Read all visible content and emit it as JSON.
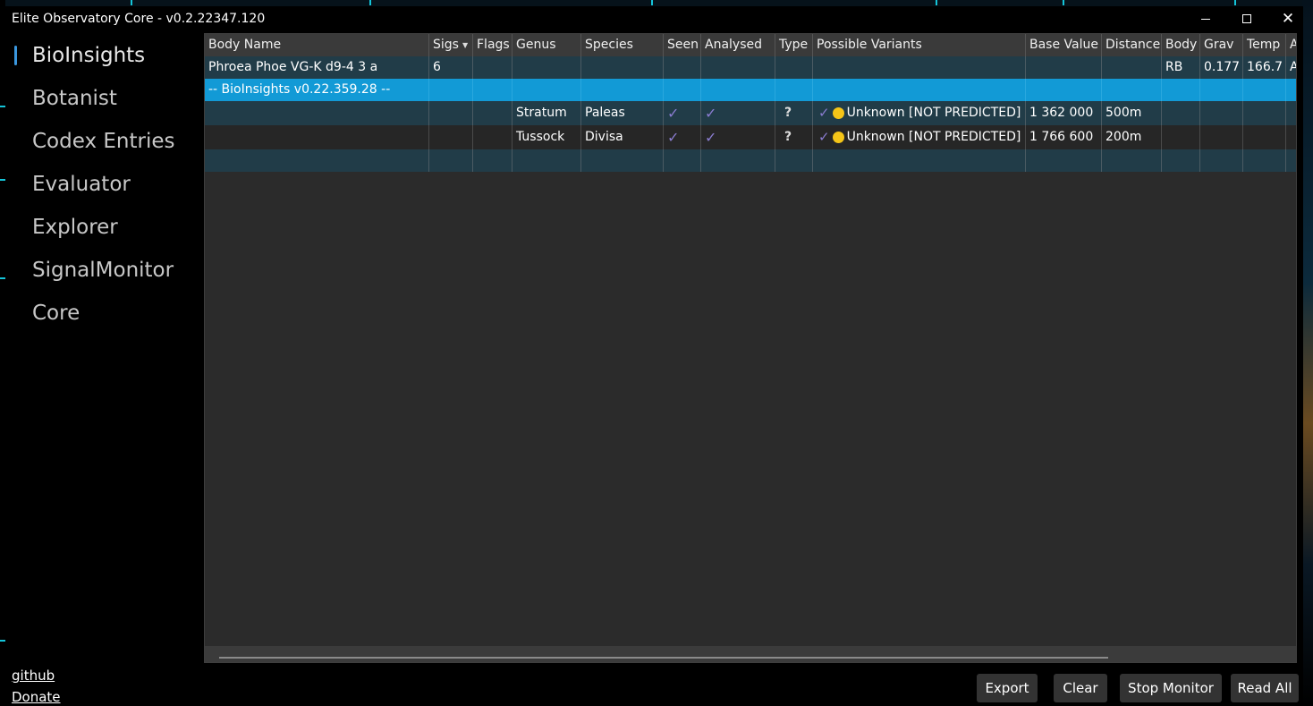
{
  "window": {
    "title": "Elite Observatory Core - v0.2.22347.120"
  },
  "sidebar": {
    "items": [
      {
        "label": "BioInsights",
        "active": true
      },
      {
        "label": "Botanist"
      },
      {
        "label": "Codex Entries"
      },
      {
        "label": "Evaluator"
      },
      {
        "label": "Explorer"
      },
      {
        "label": "SignalMonitor"
      },
      {
        "label": "Core"
      }
    ],
    "links": [
      "github",
      "Donate"
    ]
  },
  "grid": {
    "columns": [
      "Body Name",
      "Sigs",
      "Flags",
      "Genus",
      "Species",
      "Seen",
      "Analysed",
      "Type",
      "Possible Variants",
      "Base Value",
      "Distance",
      "Body",
      "Grav",
      "Temp",
      "A"
    ],
    "sort_column": "Sigs",
    "rows": [
      {
        "kind": "body",
        "body_name": "Phroea Phoe VG-K d9-4 3 a",
        "sigs": "6",
        "body": "RB",
        "grav": "0.177",
        "temp": "166.7",
        "a": "A"
      },
      {
        "kind": "plugin",
        "body_name": "-- BioInsights v0.22.359.28  --"
      },
      {
        "kind": "species",
        "genus": "Stratum",
        "species": "Paleas",
        "seen": true,
        "analysed": true,
        "type": "?",
        "variants": "Unknown [NOT PREDICTED]",
        "base_value": "1 362 000",
        "distance": "500m"
      },
      {
        "kind": "species",
        "genus": "Tussock",
        "species": "Divisa",
        "seen": true,
        "analysed": true,
        "type": "?",
        "variants": "Unknown [NOT PREDICTED]",
        "base_value": "1 766 600",
        "distance": "200m"
      },
      {
        "kind": "empty"
      }
    ]
  },
  "buttons": {
    "export": "Export",
    "clear": "Clear",
    "stop_monitor": "Stop Monitor",
    "read_all": "Read All"
  },
  "colors": {
    "accent": "#3a96dd",
    "plugin_row": "#129ad6",
    "body_row": "#213c48",
    "check": "#8a7cd0",
    "dot": "#f5c518"
  }
}
